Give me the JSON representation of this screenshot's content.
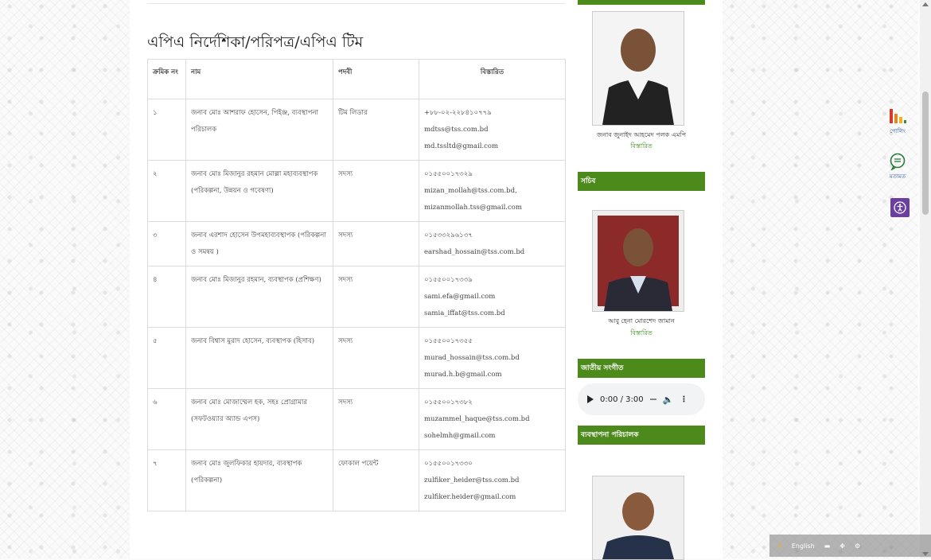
{
  "page": {
    "title": "এপিএ নির্দেশিকা/পরিপত্র/এপিএ টিম"
  },
  "table": {
    "headers": [
      "ক্রমিক নং",
      "নাম",
      "পদবী",
      "বিস্তারিত"
    ],
    "rows": [
      {
        "sl": "১",
        "name": "জনাব মোঃ আশরাফ হোসেন, পিইঞ্জ, ব্যবস্থাপনা পরিচালক",
        "designation": "টিম লিডার",
        "details": [
          "+৮৮-০২-২২৮৪১০৭৭৯",
          "mdtss@tss.com.bd",
          "md.tssltd@gmail.com"
        ]
      },
      {
        "sl": "২",
        "name": "জনাব মোঃ মিজানুর রহমান মোল্লা মহাব্যবস্থাপক (পরিকল্পনা, উন্নয়ন ও গবেষণা)",
        "designation": "সদস্য",
        "details": [
          "০১৫৫০০১৭৩২৯",
          "mizan_mollah@tss.com.bd,",
          "mizanmollah.tss@gmail.com"
        ]
      },
      {
        "sl": "৩",
        "name": "জনাব এরশাদ হোসেন উপমহাব্যবস্থাপক (পরিকল্পনা ও সমন্বয় )",
        "designation": "সদস্য",
        "details": [
          "০১৫৩৩২৯৬১৩৭",
          "earshad_hossain@tss.com.bd"
        ]
      },
      {
        "sl": "৪",
        "name": "জনাব মোঃ মিজানুর রহমান, ব্যবস্থাপক (প্রশিক্ষণ)",
        "designation": "সদস্য",
        "details": [
          "০১৫৫০০১৭৩৩৯",
          "sami.efa@gmail.com",
          "samia_iffat@tss.com.bd"
        ]
      },
      {
        "sl": "৫",
        "name": "জনাব বিশ্বাস মুরাদ হোসেন, ব্যবস্থাপক (হিসাব)",
        "designation": "সদস্য",
        "details": [
          "০১৫৫০০১৭৩৫৫",
          "murad_hossain@tss.com.bd",
          "murad.h.b@gmail.com"
        ]
      },
      {
        "sl": "৬",
        "name": "জনাব মোঃ মোজাম্মেল হক, সহঃ প্রোগ্রামার (সফটওয়্যার অ্যান্ড এপস)",
        "designation": "সদস্য",
        "details": [
          "০১৫৫০০১৭৩৮২",
          "muzammel_haque@tss.com.bd",
          "sohelmh@gmail.com"
        ]
      },
      {
        "sl": "৭",
        "name": "জনাব মোঃ জুলফিকার হায়দার, ব্যবস্থাপক (পরিকল্পনা)",
        "designation": "ফোকাল পয়েন্ট",
        "details": [
          "০১৫৫০০১৭৩৩০",
          "zulfiker_heider@tss.com.bd",
          "zulfiker.heider@gmail.com"
        ]
      }
    ]
  },
  "sidebar": {
    "minister_name": "জনাব জুনাইদ আহমেদ পলক এমপি",
    "minister_details": "বিস্তারিত",
    "secretary_header": "সচিব",
    "secretary_name": "আবু হেনা মোরশেদ জামান",
    "secretary_details": "বিস্তারিত",
    "anthem_header": "জাতীয় সংগীত",
    "audio_time": "0:00 / 3:00",
    "md_header": "ব্যবস্থাপনা পরিচালক"
  },
  "floating": {
    "poll_label": "পোলিং",
    "opinion_label": "মতামত"
  },
  "footer": {
    "language": "English"
  },
  "colors": {
    "green": "#4d8a1c",
    "link_green": "#3a8a1a",
    "accessibility_purple": "#6b3fa0"
  }
}
